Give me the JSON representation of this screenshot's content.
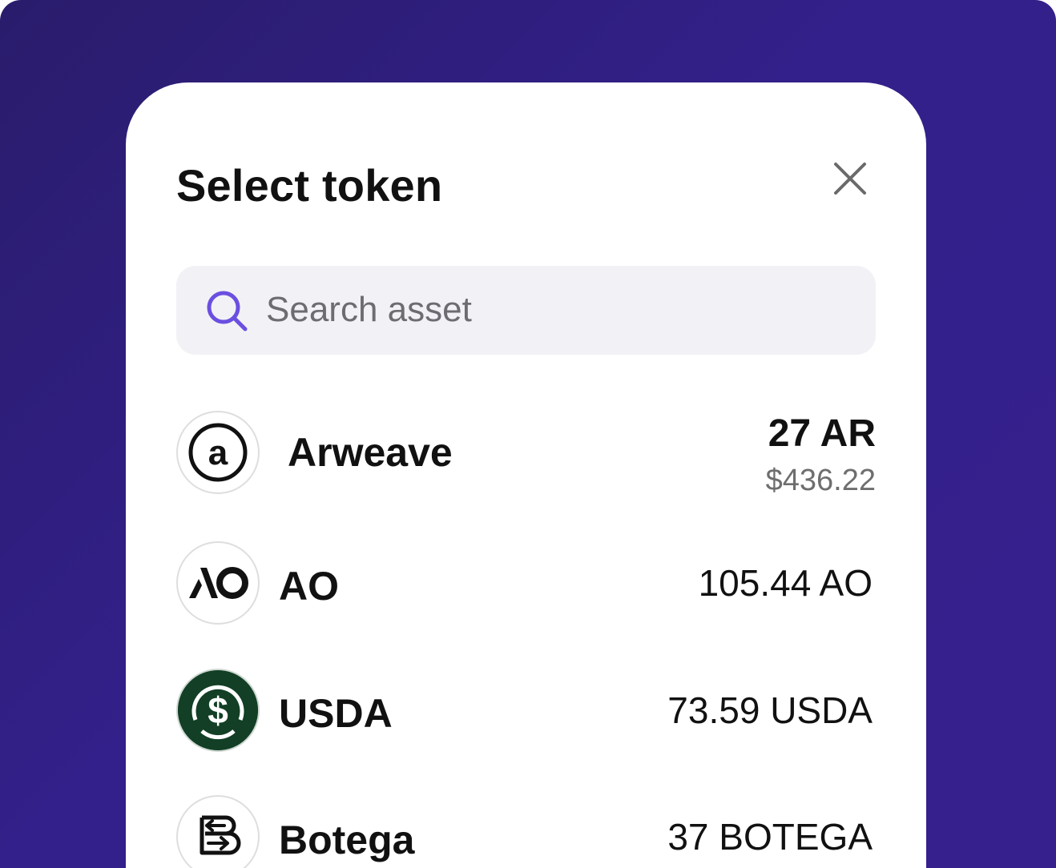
{
  "modal": {
    "title": "Select token"
  },
  "search": {
    "placeholder": "Search asset"
  },
  "tokens": [
    {
      "name": "Arweave",
      "amount": "27 AR",
      "fiat": "$436.22",
      "logo": "arweave-logo"
    },
    {
      "name": "AO",
      "amount": "105.44 AO",
      "logo": "ao-logo"
    },
    {
      "name": "USDA",
      "amount": "73.59 USDA",
      "logo": "usda-logo"
    },
    {
      "name": "Botega",
      "amount": "37 BOTEGA",
      "logo": "botega-logo"
    }
  ],
  "colors": {
    "background": "#33208a",
    "accent": "#6b4fe0",
    "usda_green": "#123f25"
  }
}
